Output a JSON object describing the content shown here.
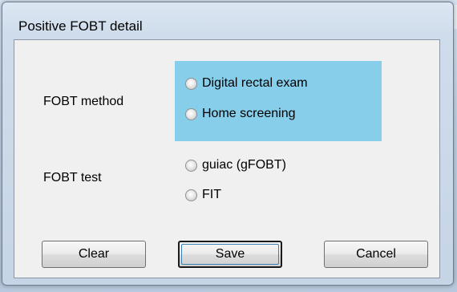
{
  "window": {
    "title": "Positive FOBT detail"
  },
  "form": {
    "method": {
      "label": "FOBT method",
      "options": [
        {
          "label": "Digital rectal exam",
          "selected": false
        },
        {
          "label": "Home screening",
          "selected": false
        }
      ],
      "highlight_color": "#87ceeb"
    },
    "test": {
      "label": "FOBT test",
      "options": [
        {
          "label": "guiac (gFOBT)",
          "selected": false
        },
        {
          "label": "FIT",
          "selected": false
        }
      ]
    }
  },
  "buttons": {
    "clear_label": "Clear",
    "save_label": "Save",
    "cancel_label": "Cancel"
  }
}
